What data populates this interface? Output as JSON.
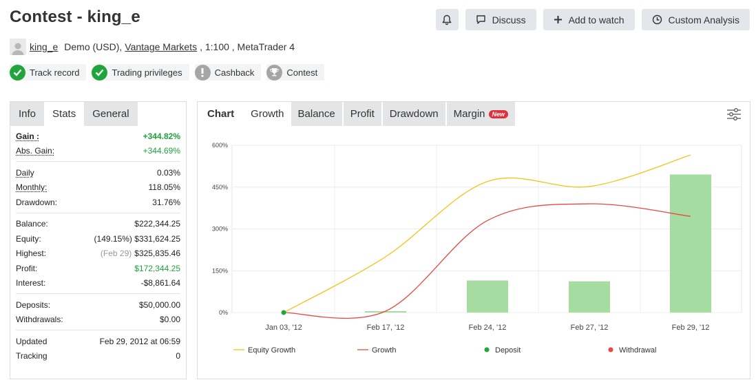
{
  "header": {
    "title": "Contest - king_e"
  },
  "actions": {
    "bell_icon": "bell-icon",
    "discuss_label": "Discuss",
    "watch_label": "Add to watch",
    "analysis_label": "Custom Analysis"
  },
  "account": {
    "user": "king_e",
    "type": "Demo (USD),",
    "broker": "Vantage Markets",
    "leverage_platform": ", 1:100 , MetaTrader 4"
  },
  "badges": [
    {
      "label": "Track record",
      "icon": "check-icon",
      "color": "#1fa53b"
    },
    {
      "label": "Trading privileges",
      "icon": "check-icon",
      "color": "#1fa53b"
    },
    {
      "label": "Cashback",
      "icon": "exclamation-icon",
      "color": "#a5a5a5"
    },
    {
      "label": "Contest",
      "icon": "trophy-icon",
      "color": "#a5a5a5"
    }
  ],
  "left_tabs": {
    "info": "Info",
    "stats": "Stats",
    "general": "General"
  },
  "stats": {
    "gain": {
      "label": "Gain :",
      "value": "+344.82%"
    },
    "abs_gain": {
      "label": "Abs. Gain:",
      "value": "+344.69%"
    },
    "daily": {
      "label": "Daily",
      "value": "0.03%"
    },
    "monthly": {
      "label": "Monthly:",
      "value": "118.05%"
    },
    "drawdown": {
      "label": "Drawdown:",
      "value": "31.76%"
    },
    "balance": {
      "label": "Balance:",
      "value": "$222,344.25"
    },
    "equity": {
      "label": "Equity:",
      "note": "(149.15%)",
      "value": "$331,624.25"
    },
    "highest": {
      "label": "Highest:",
      "note": "(Feb 29)",
      "value": "$325,835.46"
    },
    "profit": {
      "label": "Profit:",
      "value": "$172,344.25"
    },
    "interest": {
      "label": "Interest:",
      "value": "-$8,861.64"
    },
    "deposits": {
      "label": "Deposits:",
      "value": "$50,000.00"
    },
    "withdrawals": {
      "label": "Withdrawals:",
      "value": "$0.00"
    },
    "updated": {
      "label": "Updated",
      "value": "Feb 29, 2012 at 06:59"
    },
    "tracking": {
      "label": "Tracking",
      "value": "0"
    }
  },
  "chart_tabs": {
    "chart": "Chart",
    "growth": "Growth",
    "balance": "Balance",
    "profit": "Profit",
    "drawdown": "Drawdown",
    "margin": "Margin",
    "new_badge": "New"
  },
  "chart_data": {
    "type": "line",
    "categories": [
      "Jan 03, '12",
      "Feb 17, '12",
      "Feb 24, '12",
      "Feb 27, '12",
      "Feb 29, '12"
    ],
    "y_ticks": [
      "0%",
      "150%",
      "300%",
      "450%",
      "600%"
    ],
    "ylim": [
      0,
      600
    ],
    "grid": true,
    "legend_position": "bottom",
    "series": [
      {
        "name": "Equity Growth",
        "color": "#f2c31a",
        "values": [
          0,
          200,
          470,
          452,
          565
        ]
      },
      {
        "name": "Growth",
        "color": "#e8483f",
        "values": [
          0,
          5,
          330,
          390,
          345
        ]
      }
    ],
    "bars": {
      "color": "#a6dca2",
      "values": [
        0,
        5,
        115,
        112,
        495
      ]
    },
    "markers": [
      {
        "name": "Deposit",
        "color": "#1aa83a",
        "points": [
          {
            "x": "Jan 03, '12",
            "y": 0
          }
        ]
      },
      {
        "name": "Withdrawal",
        "color": "#e8483f",
        "points": []
      }
    ]
  }
}
